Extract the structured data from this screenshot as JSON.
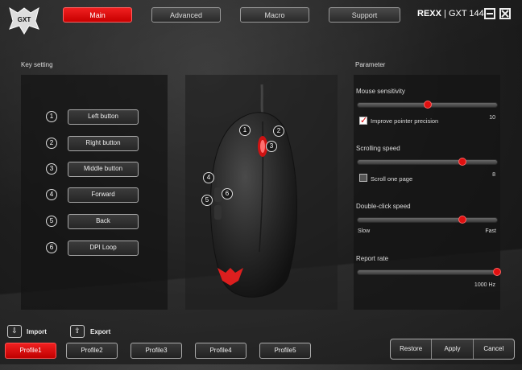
{
  "header": {
    "logo_text": "GXT",
    "tabs": [
      {
        "label": "Main",
        "active": true
      },
      {
        "label": "Advanced",
        "active": false
      },
      {
        "label": "Macro",
        "active": false
      },
      {
        "label": "Support",
        "active": false
      }
    ],
    "product_brand": "REXX",
    "product_sep": "|",
    "product_model": "GXT 144"
  },
  "key_setting": {
    "title": "Key setting",
    "items": [
      {
        "num": "1",
        "label": "Left button"
      },
      {
        "num": "2",
        "label": "Right button"
      },
      {
        "num": "3",
        "label": "Middle button"
      },
      {
        "num": "4",
        "label": "Forward"
      },
      {
        "num": "5",
        "label": "Back"
      },
      {
        "num": "6",
        "label": "DPI Loop"
      }
    ]
  },
  "mouse_markers": [
    "1",
    "2",
    "3",
    "4",
    "5",
    "6"
  ],
  "parameter": {
    "title": "Parameter",
    "sensitivity": {
      "label": "Mouse sensitivity",
      "value": "10",
      "level": 0.5
    },
    "pointer_precision": {
      "label": "Improve pointer precision",
      "checked": true
    },
    "scrolling": {
      "label": "Scrolling speed",
      "value": "8",
      "level": 0.75
    },
    "scroll_page": {
      "label": "Scroll one page",
      "checked": false
    },
    "double_click": {
      "label": "Double-click speed",
      "level": 0.75,
      "min_label": "Slow",
      "max_label": "Fast"
    },
    "report_rate": {
      "label": "Report rate",
      "value": "1000 Hz",
      "level": 1.0
    }
  },
  "io": {
    "import_label": "Import",
    "export_label": "Export"
  },
  "profiles": [
    {
      "label": "Profile1",
      "active": true
    },
    {
      "label": "Profile2",
      "active": false
    },
    {
      "label": "Profile3",
      "active": false
    },
    {
      "label": "Profile4",
      "active": false
    },
    {
      "label": "Profile5",
      "active": false
    }
  ],
  "actions": {
    "restore": "Restore",
    "apply": "Apply",
    "cancel": "Cancel"
  },
  "colors": {
    "accent": "#e01010",
    "background": "#1e1e1e"
  }
}
